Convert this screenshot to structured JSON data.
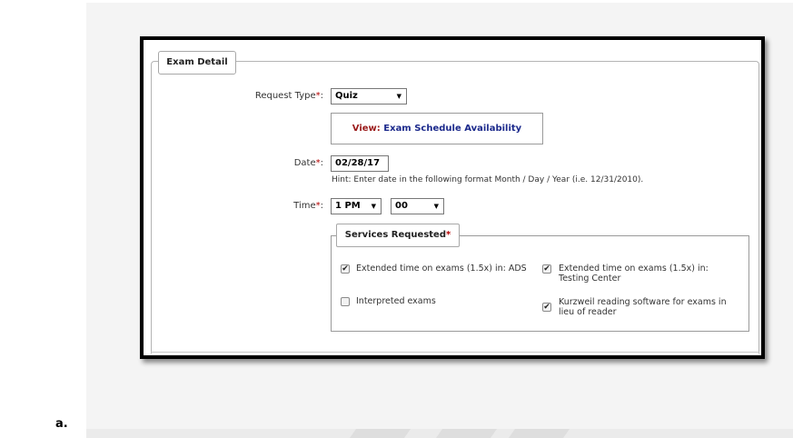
{
  "list_marker": "a.",
  "form": {
    "legend": "Exam Detail",
    "request_type": {
      "label": "Request Type",
      "required_mark": "*",
      "colon": ":",
      "value": "Quiz"
    },
    "view": {
      "prefix": "View: ",
      "link": "Exam Schedule Availability"
    },
    "date": {
      "label": "Date",
      "required_mark": "*",
      "colon": ":",
      "value": "02/28/17",
      "hint": "Hint: Enter date in the following format Month / Day / Year (i.e. 12/31/2010)."
    },
    "time": {
      "label": "Time",
      "required_mark": "*",
      "colon": ":",
      "hour": "1 PM",
      "minute": "00"
    },
    "services": {
      "legend": "Services Requested",
      "required_mark": "*",
      "options": [
        {
          "line1": "Extended time on exams (1.5x) in: ADS",
          "line2": "",
          "checked": true
        },
        {
          "line1": "Extended time on exams (1.5x) in:",
          "line2": "Testing Center",
          "checked": true
        },
        {
          "line1": "Interpreted exams",
          "line2": "",
          "checked": false
        },
        {
          "line1": "Kurzweil reading software for exams in",
          "line2": "lieu of reader",
          "checked": true
        }
      ]
    }
  },
  "icons": {
    "dropdown": "caret-down-icon",
    "checkbox_checked": "check-icon"
  },
  "colors": {
    "required": "#b40000",
    "link": "#1c2a8c",
    "view_label": "#9b1b1b"
  }
}
